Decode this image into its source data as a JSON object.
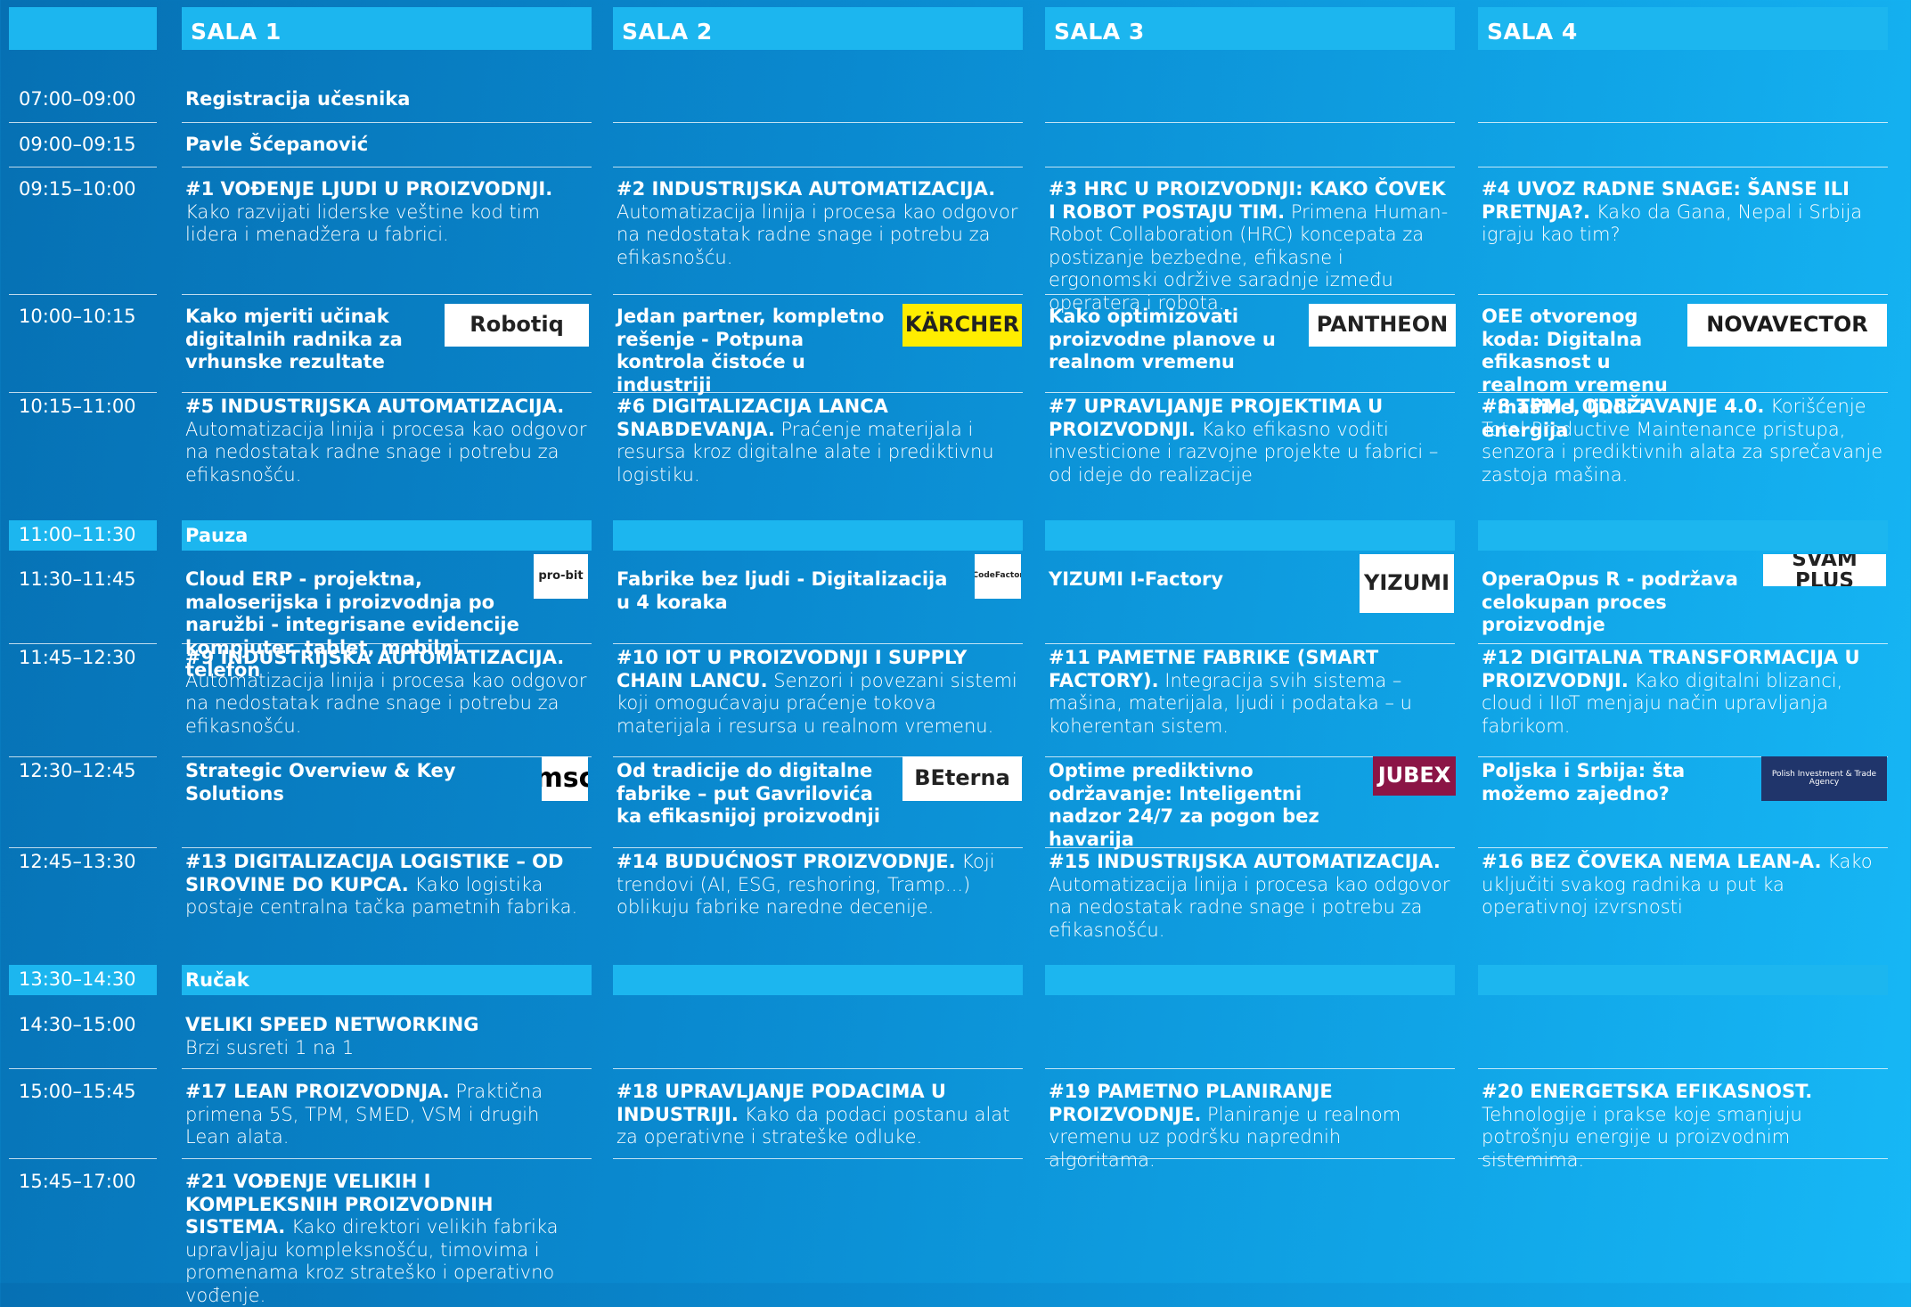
{
  "rooms": [
    "SALA 1",
    "SALA 2",
    "SALA 3",
    "SALA 4"
  ],
  "rows": [
    {
      "time": "07:00–09:00",
      "full": "Registracija učesnika"
    },
    {
      "time": "09:00–09:15",
      "full": "Pavle Šćepanović"
    },
    {
      "time": "09:15–10:00",
      "cells": [
        {
          "title": "#1 VOĐENJE LJUDI U PROIZVODNJI.",
          "text": "Kako razvijati liderske veštine kod tim lidera i menadžera u fabrici."
        },
        {
          "title": "#2 INDUSTRIJSKA AUTOMATIZACIJA.",
          "text": "Automatizacija linija i procesa kao odgovor na nedostatak radne snage i potrebu za efikasnošću."
        },
        {
          "title": "#3 HRC U PROIZVODNJI: KAKO ČOVEK I ROBOT POSTAJU TIM.",
          "text": "Primena Human-Robot Collaboration (HRC) koncepata za postizanje bezbedne, efikasne i ergonomski održive saradnje između operatera i robota."
        },
        {
          "title": "#4 UVOZ RADNE SNAGE: ŠANSE ILI PRETNJA?.",
          "text": "Kako da Gana, Nepal i Srbija igraju kao tim?"
        }
      ]
    },
    {
      "time": "10:00–10:15",
      "cells": [
        {
          "bold": "Kako mjeriti učinak digitalnih radnika za vrhunske rezultate",
          "logo": "Robotiq"
        },
        {
          "bold": "Jedan partner, kompletno rešenje - Potpuna kontrola čistoće u industriji",
          "logo": "KÄRCHER"
        },
        {
          "bold": "Kako optimizovati proizvodne planove u realnom vremenu",
          "logo": "PANTHEON"
        },
        {
          "bold": "OEE otvorenog koda: Digitalna efikasnost u realnom vremenu – mašine, ljudi i energija",
          "logo": "NOVAVECTOR"
        }
      ]
    },
    {
      "time": "10:15–11:00",
      "cells": [
        {
          "title": "#5 INDUSTRIJSKA AUTOMATIZACIJA.",
          "text": "Automatizacija linija i procesa kao odgovor na nedostatak radne snage i potrebu za efikasnošću."
        },
        {
          "title": "#6 DIGITALIZACIJA LANCA SNABDEVANJA.",
          "text": "Praćenje materijala i resursa kroz digitalne alate i prediktivnu logistiku."
        },
        {
          "title": "#7 UPRAVLJANJE PROJEKTIMA U PROIZVODNJI.",
          "text": "Kako efikasno voditi investicione i razvojne projekte u fabrici – od ideje do realizacije"
        },
        {
          "title": "#8 TPM I ODRŽAVANJE 4.0.",
          "text": "Korišćenje Total Productive Maintenance pristupa, senzora i prediktivnih alata za sprečavanje zastoja mašina."
        }
      ]
    },
    {
      "time": "11:00–11:30",
      "full": "Pauza"
    },
    {
      "time": "11:30–11:45",
      "cells": [
        {
          "bold": "Cloud ERP - projektna, maloserijska i proizvodnja po naružbi - integrisane evidencije kompjuter, tablet, mobilni telefon",
          "logo": "pro-bit"
        },
        {
          "bold": "Fabrike bez ljudi - Digitalizacija u 4 koraka",
          "logo": "5CodeFactory"
        },
        {
          "bold": "YIZUMI I-Factory",
          "logo": "YIZUMI"
        },
        {
          "bold": "OperaOpus R - podržava celokupan proces proizvodnje",
          "logo": "SVAM PLUS"
        }
      ]
    },
    {
      "time": "11:45–12:30",
      "cells": [
        {
          "title": "#9 INDUSTRIJSKA AUTOMATIZACIJA.",
          "text": "Automatizacija linija i procesa kao odgovor na nedostatak radne snage i potrebu za efikasnošću."
        },
        {
          "title": "#10 IOT U PROIZVODNJI I SUPPLY CHAIN LANCU.",
          "text": "Senzori i povezani sistemi koji omogućavaju praćenje tokova materijala i resursa u realnom vremenu."
        },
        {
          "title": "#11 PAMETNE FABRIKE (SMART FACTORY).",
          "text": "Integracija svih sistema – mašina, materijala, ljudi i podataka – u koherentan sistem."
        },
        {
          "title": "#12 DIGITALNA TRANSFORMACIJA U PROIZVODNJI.",
          "text": "Kako digitalni blizanci, cloud i IIoT menjaju način upravljanja fabrikom."
        }
      ]
    },
    {
      "time": "12:30–12:45",
      "cells": [
        {
          "bold": "Strategic Overview & Key Solutions",
          "logo": "msc"
        },
        {
          "bold": "Od tradicije do digitalne fabrike – put Gavrilovića ka efikasnijoj proizvodnji",
          "logo": "BEterna"
        },
        {
          "bold": "Optime prediktivno održavanje: Inteligentni nadzor 24/7 za pogon bez havarija",
          "logo": "JUBEX"
        },
        {
          "bold": "Poljska i Srbija: šta možemo zajedno?",
          "logo": "Polish Investment & Trade Agency"
        }
      ]
    },
    {
      "time": "12:45–13:30",
      "cells": [
        {
          "title": "#13 DIGITALIZACIJA LOGISTIKE – OD SIROVINE DO KUPCA.",
          "text": "Kako logistika postaje centralna tačka pametnih fabrika."
        },
        {
          "title": "#14 BUDUĆNOST PROIZVODNJE.",
          "text": "Koji trendovi (AI, ESG, reshoring, Tramp...) oblikuju fabrike naredne decenije."
        },
        {
          "title": "#15 INDUSTRIJSKA AUTOMATIZACIJA.",
          "text": "Automatizacija linija i procesa kao odgovor na nedostatak radne snage i potrebu za efikasnošću."
        },
        {
          "title": "#16 BEZ ČOVEKA NEMA LEAN-A.",
          "text": "Kako uključiti svakog radnika u put ka operativnoj izvrsnosti"
        }
      ]
    },
    {
      "time": "13:30–14:30",
      "full": "Ručak"
    },
    {
      "time": "14:30–15:00",
      "cells": [
        {
          "title": "VELIKI SPEED NETWORKING",
          "text": "Brzi susreti 1 na 1",
          "br": true
        },
        null,
        null,
        null
      ]
    },
    {
      "time": "15:00–15:45",
      "cells": [
        {
          "title": "#17 LEAN PROIZVODNJA.",
          "text": "Praktična primena 5S, TPM, SMED, VSM i drugih Lean alata."
        },
        {
          "title": "#18 UPRAVLJANJE PODACIMA U INDUSTRIJI.",
          "text": "Kako da podaci postanu alat za operativne i strateške odluke."
        },
        {
          "title": "#19 PAMETNO PLANIRANJE PROIZVODNJE.",
          "text": "Planiranje u realnom vremenu uz podršku naprednih algoritama."
        },
        {
          "title": "#20 ENERGETSKA EFIKASNOST.",
          "text": "Tehnologije i prakse koje smanjuju potrošnju energije u proizvodnim sistemima."
        }
      ]
    },
    {
      "time": "15:45–17:00",
      "cells": [
        {
          "title": "#21 VOĐENJE VELIKIH I KOMPLEKSNIH PROIZVODNIH SISTEMA.",
          "text": "Kako direktori velikih fabrika upravljaju kompleksnošću, timovima i promenama kroz strateško i operativno vođenje."
        },
        null,
        null,
        null
      ]
    }
  ]
}
